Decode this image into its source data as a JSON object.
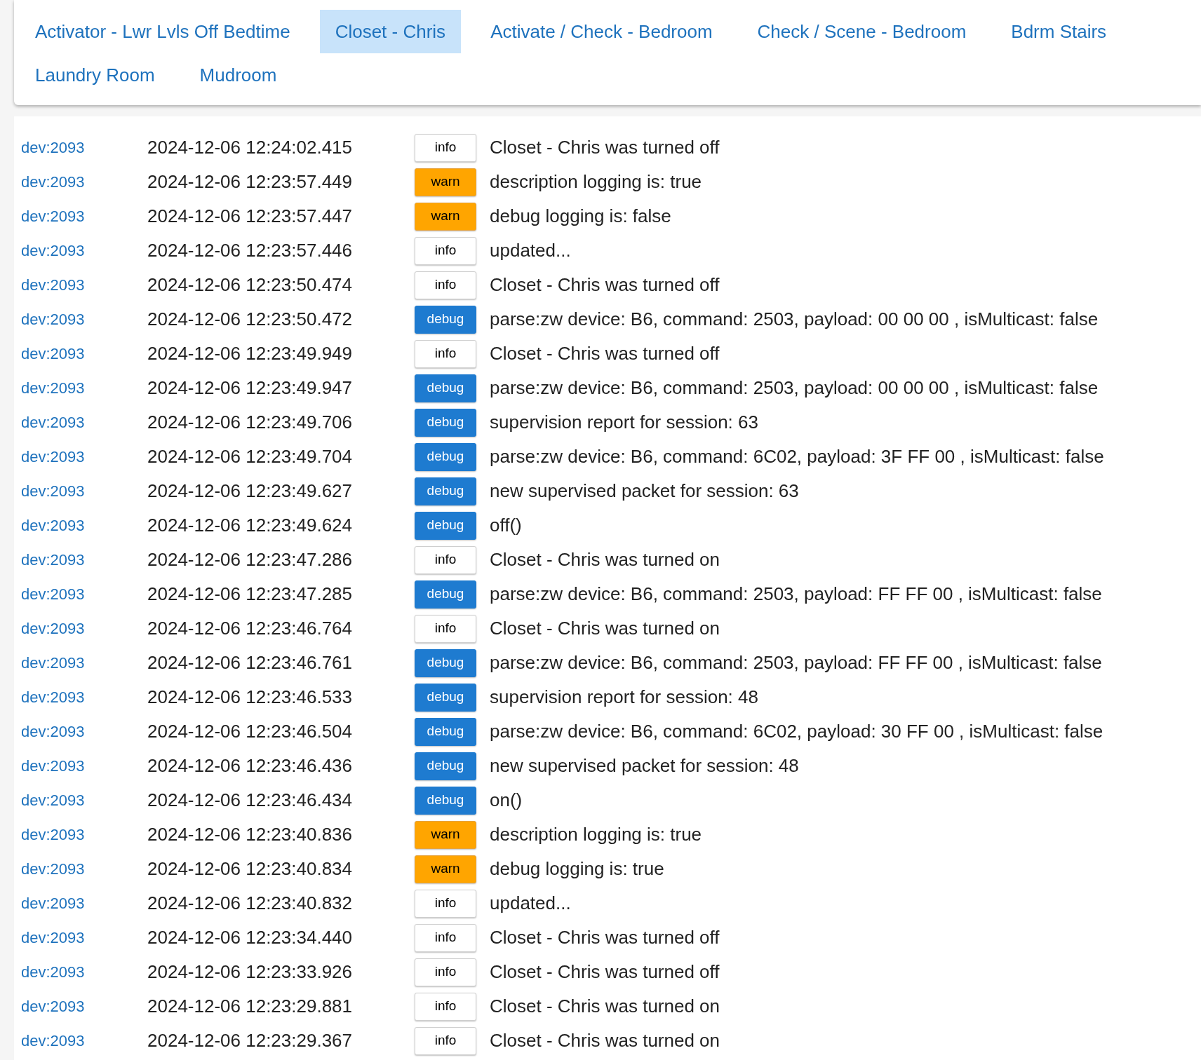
{
  "tabs": [
    {
      "label": "Activator - Lwr Lvls Off Bedtime",
      "selected": false
    },
    {
      "label": "Closet - Chris",
      "selected": true
    },
    {
      "label": "Activate / Check - Bedroom",
      "selected": false
    },
    {
      "label": "Check / Scene - Bedroom",
      "selected": false
    },
    {
      "label": "Bdrm Stairs",
      "selected": false
    },
    {
      "label": "Laundry Room",
      "selected": false
    },
    {
      "label": "Mudroom",
      "selected": false
    }
  ],
  "log": [
    {
      "source": "dev:2093",
      "time": "2024-12-06 12:24:02.415",
      "level": "info",
      "message": "Closet - Chris was turned off"
    },
    {
      "source": "dev:2093",
      "time": "2024-12-06 12:23:57.449",
      "level": "warn",
      "message": "description logging is: true"
    },
    {
      "source": "dev:2093",
      "time": "2024-12-06 12:23:57.447",
      "level": "warn",
      "message": "debug logging is: false"
    },
    {
      "source": "dev:2093",
      "time": "2024-12-06 12:23:57.446",
      "level": "info",
      "message": "updated..."
    },
    {
      "source": "dev:2093",
      "time": "2024-12-06 12:23:50.474",
      "level": "info",
      "message": "Closet - Chris was turned off"
    },
    {
      "source": "dev:2093",
      "time": "2024-12-06 12:23:50.472",
      "level": "debug",
      "message": "parse:zw device: B6, command: 2503, payload: 00 00 00 , isMulticast: false"
    },
    {
      "source": "dev:2093",
      "time": "2024-12-06 12:23:49.949",
      "level": "info",
      "message": "Closet - Chris was turned off"
    },
    {
      "source": "dev:2093",
      "time": "2024-12-06 12:23:49.947",
      "level": "debug",
      "message": "parse:zw device: B6, command: 2503, payload: 00 00 00 , isMulticast: false"
    },
    {
      "source": "dev:2093",
      "time": "2024-12-06 12:23:49.706",
      "level": "debug",
      "message": "supervision report for session: 63"
    },
    {
      "source": "dev:2093",
      "time": "2024-12-06 12:23:49.704",
      "level": "debug",
      "message": "parse:zw device: B6, command: 6C02, payload: 3F FF 00 , isMulticast: false"
    },
    {
      "source": "dev:2093",
      "time": "2024-12-06 12:23:49.627",
      "level": "debug",
      "message": "new supervised packet for session: 63"
    },
    {
      "source": "dev:2093",
      "time": "2024-12-06 12:23:49.624",
      "level": "debug",
      "message": "off()"
    },
    {
      "source": "dev:2093",
      "time": "2024-12-06 12:23:47.286",
      "level": "info",
      "message": "Closet - Chris was turned on"
    },
    {
      "source": "dev:2093",
      "time": "2024-12-06 12:23:47.285",
      "level": "debug",
      "message": "parse:zw device: B6, command: 2503, payload: FF FF 00 , isMulticast: false"
    },
    {
      "source": "dev:2093",
      "time": "2024-12-06 12:23:46.764",
      "level": "info",
      "message": "Closet - Chris was turned on"
    },
    {
      "source": "dev:2093",
      "time": "2024-12-06 12:23:46.761",
      "level": "debug",
      "message": "parse:zw device: B6, command: 2503, payload: FF FF 00 , isMulticast: false"
    },
    {
      "source": "dev:2093",
      "time": "2024-12-06 12:23:46.533",
      "level": "debug",
      "message": "supervision report for session: 48"
    },
    {
      "source": "dev:2093",
      "time": "2024-12-06 12:23:46.504",
      "level": "debug",
      "message": "parse:zw device: B6, command: 6C02, payload: 30 FF 00 , isMulticast: false"
    },
    {
      "source": "dev:2093",
      "time": "2024-12-06 12:23:46.436",
      "level": "debug",
      "message": "new supervised packet for session: 48"
    },
    {
      "source": "dev:2093",
      "time": "2024-12-06 12:23:46.434",
      "level": "debug",
      "message": "on()"
    },
    {
      "source": "dev:2093",
      "time": "2024-12-06 12:23:40.836",
      "level": "warn",
      "message": "description logging is: true"
    },
    {
      "source": "dev:2093",
      "time": "2024-12-06 12:23:40.834",
      "level": "warn",
      "message": "debug logging is: true"
    },
    {
      "source": "dev:2093",
      "time": "2024-12-06 12:23:40.832",
      "level": "info",
      "message": "updated..."
    },
    {
      "source": "dev:2093",
      "time": "2024-12-06 12:23:34.440",
      "level": "info",
      "message": "Closet - Chris was turned off"
    },
    {
      "source": "dev:2093",
      "time": "2024-12-06 12:23:33.926",
      "level": "info",
      "message": "Closet - Chris was turned off"
    },
    {
      "source": "dev:2093",
      "time": "2024-12-06 12:23:29.881",
      "level": "info",
      "message": "Closet - Chris was turned on"
    },
    {
      "source": "dev:2093",
      "time": "2024-12-06 12:23:29.367",
      "level": "info",
      "message": "Closet - Chris was turned on"
    }
  ]
}
